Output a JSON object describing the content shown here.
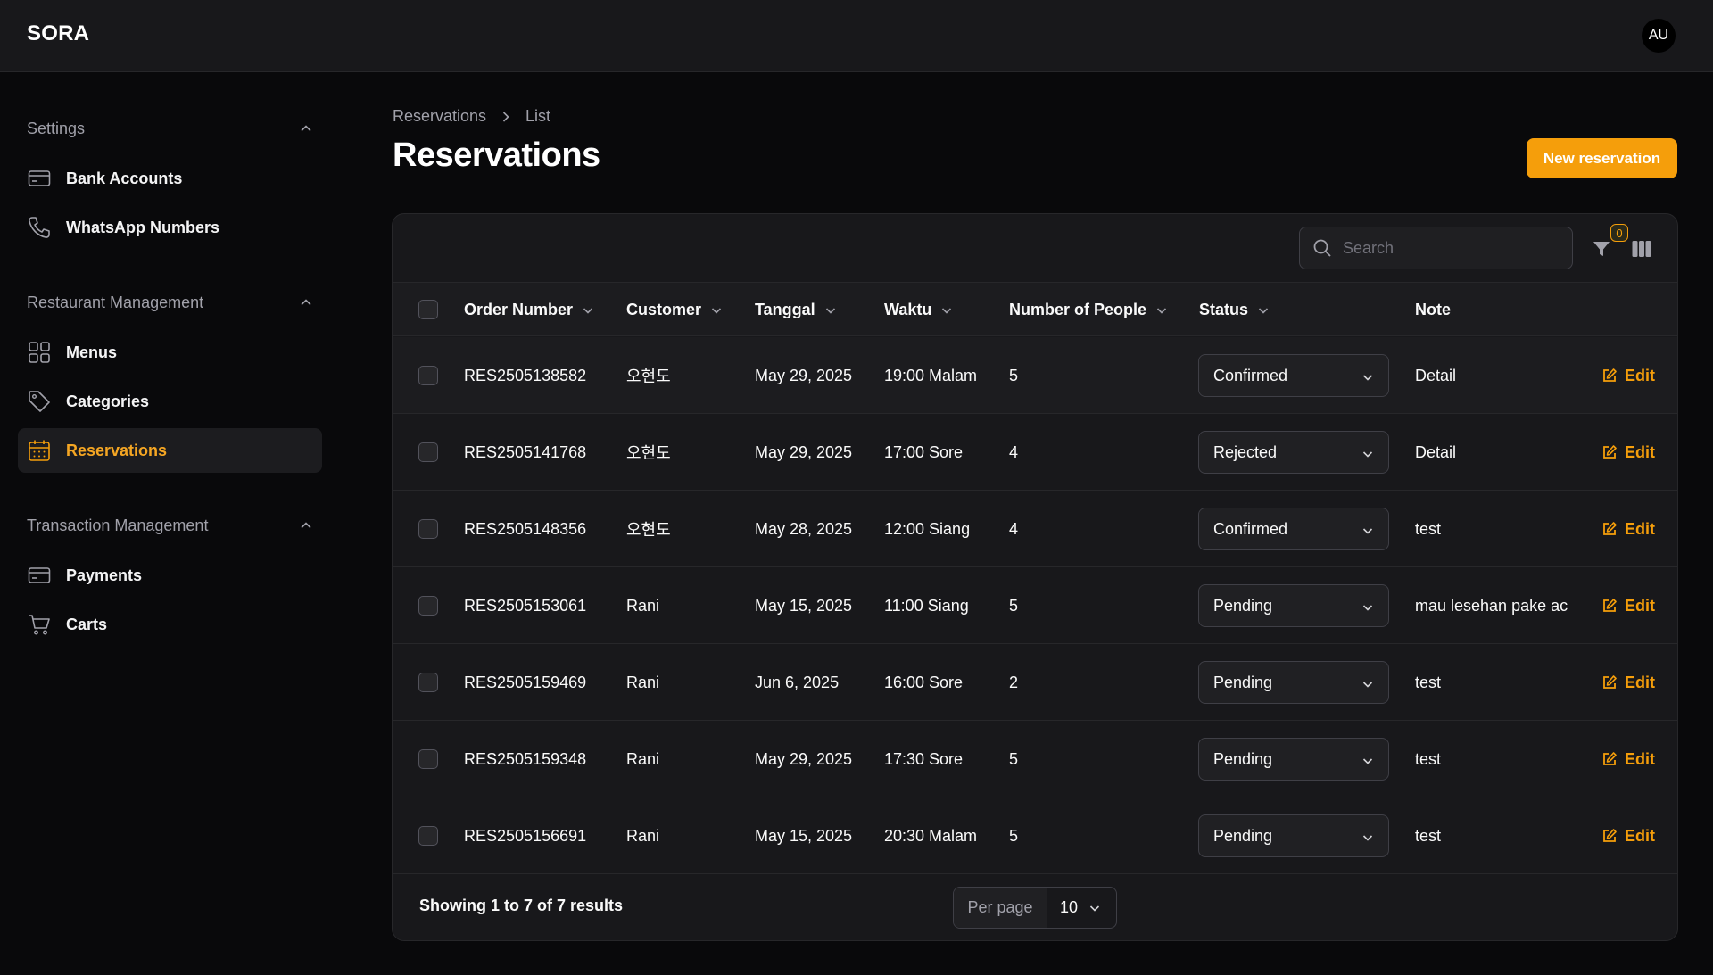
{
  "app": {
    "brand": "SORA",
    "avatar_initials": "AU"
  },
  "sidebar": {
    "groups": [
      {
        "label": "Settings",
        "items": [
          {
            "label": "Bank Accounts",
            "icon": "credit-card-icon"
          },
          {
            "label": "WhatsApp Numbers",
            "icon": "phone-icon"
          }
        ]
      },
      {
        "label": "Restaurant Management",
        "items": [
          {
            "label": "Menus",
            "icon": "grid-icon"
          },
          {
            "label": "Categories",
            "icon": "tag-icon"
          },
          {
            "label": "Reservations",
            "icon": "calendar-icon",
            "active": true
          }
        ]
      },
      {
        "label": "Transaction Management",
        "items": [
          {
            "label": "Payments",
            "icon": "credit-card-icon"
          },
          {
            "label": "Carts",
            "icon": "cart-icon"
          }
        ]
      }
    ]
  },
  "breadcrumb": {
    "parent": "Reservations",
    "current": "List"
  },
  "page": {
    "title": "Reservations",
    "new_button": "New reservation"
  },
  "toolbar": {
    "search_placeholder": "Search",
    "filter_count": "0"
  },
  "table": {
    "columns": [
      "Order Number",
      "Customer",
      "Tanggal",
      "Waktu",
      "Number of People",
      "Status",
      "Note"
    ],
    "edit_label": "Edit",
    "rows": [
      {
        "order": "RES2505138582",
        "customer": "오현도",
        "date": "May 29, 2025",
        "time": "19:00 Malam",
        "people": "5",
        "status": "Confirmed",
        "note": "Detail"
      },
      {
        "order": "RES2505141768",
        "customer": "오현도",
        "date": "May 29, 2025",
        "time": "17:00 Sore",
        "people": "4",
        "status": "Rejected",
        "note": "Detail"
      },
      {
        "order": "RES2505148356",
        "customer": "오현도",
        "date": "May 28, 2025",
        "time": "12:00 Siang",
        "people": "4",
        "status": "Confirmed",
        "note": "test"
      },
      {
        "order": "RES2505153061",
        "customer": "Rani",
        "date": "May 15, 2025",
        "time": "11:00 Siang",
        "people": "5",
        "status": "Pending",
        "note": "mau lesehan pake ac"
      },
      {
        "order": "RES2505159469",
        "customer": "Rani",
        "date": "Jun 6, 2025",
        "time": "16:00 Sore",
        "people": "2",
        "status": "Pending",
        "note": "test"
      },
      {
        "order": "RES2505159348",
        "customer": "Rani",
        "date": "May 29, 2025",
        "time": "17:30 Sore",
        "people": "5",
        "status": "Pending",
        "note": "test"
      },
      {
        "order": "RES2505156691",
        "customer": "Rani",
        "date": "May 15, 2025",
        "time": "20:30 Malam",
        "people": "5",
        "status": "Pending",
        "note": "test"
      }
    ]
  },
  "footer": {
    "summary": "Showing 1 to 7 of 7 results",
    "per_page_label": "Per page",
    "per_page_value": "10"
  },
  "colors": {
    "accent": "#f59e0b",
    "background": "#09090b",
    "surface": "#18181b"
  }
}
